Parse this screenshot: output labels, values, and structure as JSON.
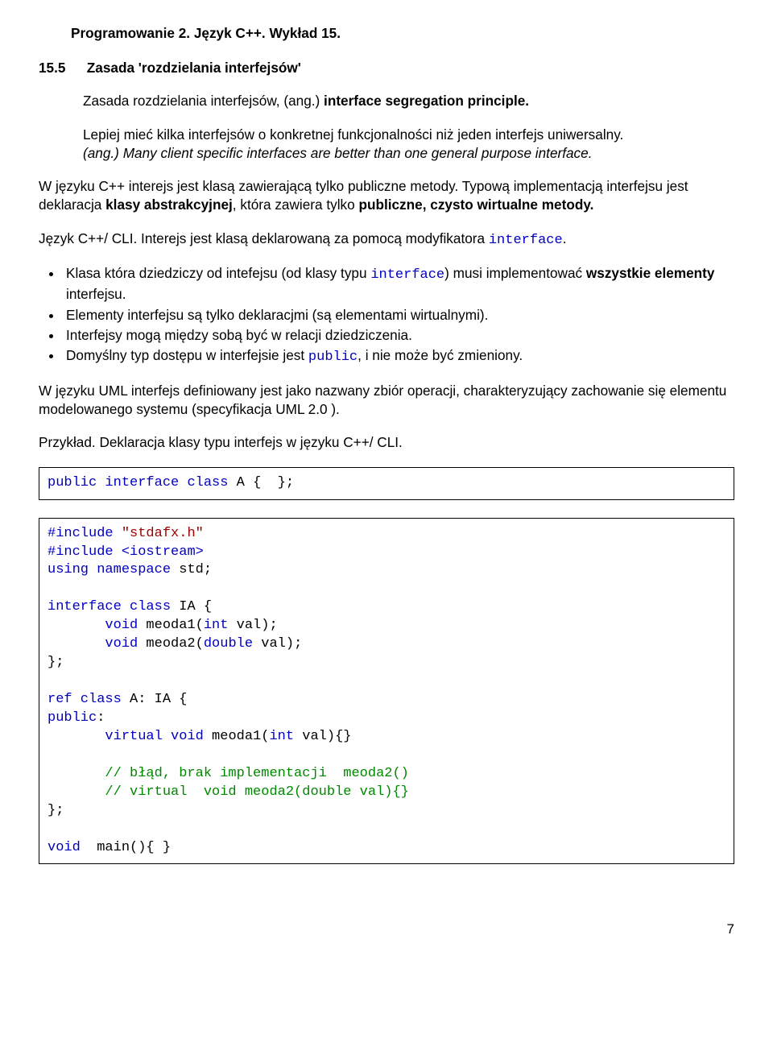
{
  "header": "Programowanie 2. Język C++. Wykład 15.",
  "section": {
    "num": "15.5",
    "title": "Zasada 'rozdzielania interfejsów'"
  },
  "definition": {
    "prefix": "Zasada rozdzielania interfejsów, (ang.)",
    "term": " interface segregation principle."
  },
  "quote": {
    "text": "Lepiej mieć kilka interfejsów o konkretnej funkcjonalności niż jeden interfejs uniwersalny.",
    "eng_prefix": "(ang.) ",
    "eng": "Many client specific interfaces are better than one general purpose interface."
  },
  "para1": {
    "a": "W języku C++ interejs jest klasą zawierającą tylko publiczne metody. Typową implementacją interfejsu jest deklaracja ",
    "b": "klasy abstrakcyjnej",
    "c": ", która  zawiera tylko ",
    "d": "publiczne, czysto wirtualne metody.",
    "e": ""
  },
  "langline": {
    "a": "Język C++/ CLI. Interejs jest klasą deklarowaną za pomocą modyfikatora ",
    "b": "interface",
    "c": "."
  },
  "bullets": {
    "i1a": "Klasa która dziedziczy od intefejsu (od klasy typu ",
    "i1b": "interface",
    "i1c": ") musi implementować ",
    "i1d": "wszystkie elementy",
    "i1e": " interfejsu.",
    "i2": "Elementy interfejsu są tylko deklaracjmi (są elementami wirtualnymi).",
    "i3": "Interfejsy mogą między sobą być w relacji dziedziczenia.",
    "i4a": "Domyślny typ dostępu w interfejsie jest ",
    "i4b": "public",
    "i4c": ", i nie może być zmieniony."
  },
  "umlpara": "W języku UML interfejs definiowany jest jako nazwany zbiór operacji, charakteryzujący zachowanie się elementu modelowanego systemu (specyfikacja UML 2.0 ).",
  "example_label": "Przykład. Deklaracja klasy typu interfejs w języku C++/ CLI.",
  "codebox1": {
    "l1a": "public",
    "l1b": " interface",
    "l1c": " class",
    "l1d": " A {  };"
  },
  "codebox2": {
    "l1a": "#include",
    "l1b": " \"stdafx.h\"",
    "l2a": "#include",
    "l2b": " <iostream>",
    "l3a": "using",
    "l3b": " namespace",
    "l3c": " std;",
    "blank1": " ",
    "l4a": "interface",
    "l4b": " class",
    "l4c": " IA {",
    "l5a": "       void",
    "l5b": " meoda1(",
    "l5c": "int",
    "l5d": " val);",
    "l6a": "       void",
    "l6b": " meoda2(",
    "l6c": "double",
    "l6d": " val);",
    "l7": "};",
    "blank2": " ",
    "l8a": "ref",
    "l8b": " class",
    "l8c": " A: IA {",
    "l9a": "public",
    "l9b": ":",
    "l10a": "       virtual",
    "l10b": " void",
    "l10c": " meoda1(",
    "l10d": "int",
    "l10e": " val){}",
    "blank3": " ",
    "l11": "       // błąd, brak implementacji  meoda2()",
    "l12": "       // virtual  void meoda2(double val){}",
    "l13": "};",
    "blank4": " ",
    "l14a": "void",
    "l14b": "  main(){ }"
  },
  "pagenum": "7"
}
